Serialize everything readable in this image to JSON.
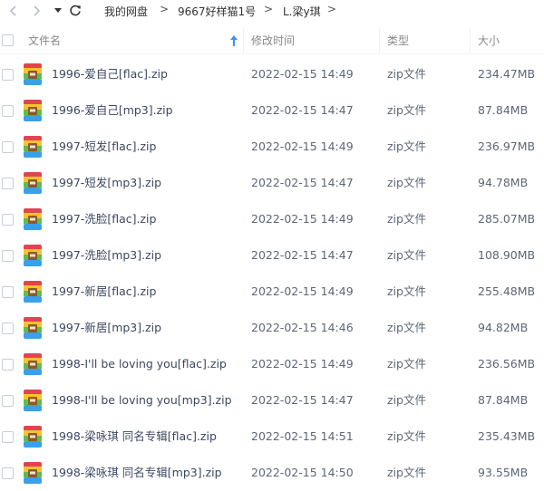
{
  "navigation": {
    "breadcrumbs": [
      "我的网盘",
      "9667好样猫1号",
      "L.梁y琪"
    ],
    "separator": ">"
  },
  "table": {
    "columns": {
      "name": "文件名",
      "modified": "修改时间",
      "type": "类型",
      "size": "大小"
    },
    "rows": [
      {
        "name": "1996-爱自己[flac].zip",
        "modified": "2022-02-15 14:49",
        "type": "zip文件",
        "size": "234.47MB"
      },
      {
        "name": "1996-爱自己[mp3].zip",
        "modified": "2022-02-15 14:47",
        "type": "zip文件",
        "size": "87.84MB"
      },
      {
        "name": "1997-短发[flac].zip",
        "modified": "2022-02-15 14:49",
        "type": "zip文件",
        "size": "236.97MB"
      },
      {
        "name": "1997-短发[mp3].zip",
        "modified": "2022-02-15 14:47",
        "type": "zip文件",
        "size": "94.78MB"
      },
      {
        "name": "1997-洗脸[flac].zip",
        "modified": "2022-02-15 14:49",
        "type": "zip文件",
        "size": "285.07MB"
      },
      {
        "name": "1997-洗脸[mp3].zip",
        "modified": "2022-02-15 14:47",
        "type": "zip文件",
        "size": "108.90MB"
      },
      {
        "name": "1997-新居[flac].zip",
        "modified": "2022-02-15 14:49",
        "type": "zip文件",
        "size": "255.48MB"
      },
      {
        "name": "1997-新居[mp3].zip",
        "modified": "2022-02-15 14:46",
        "type": "zip文件",
        "size": "94.82MB"
      },
      {
        "name": "1998-I'll be loving you[flac].zip",
        "modified": "2022-02-15 14:49",
        "type": "zip文件",
        "size": "236.56MB"
      },
      {
        "name": "1998-I'll be loving you[mp3].zip",
        "modified": "2022-02-15 14:47",
        "type": "zip文件",
        "size": "87.84MB"
      },
      {
        "name": "1998-梁咏琪 同名专辑[flac].zip",
        "modified": "2022-02-15 14:51",
        "type": "zip文件",
        "size": "235.43MB"
      },
      {
        "name": "1998-梁咏琪 同名专辑[mp3].zip",
        "modified": "2022-02-15 14:50",
        "type": "zip文件",
        "size": "93.55MB"
      }
    ]
  },
  "colors": {
    "accent": "#3b8cff",
    "zip_red": "#e2444f",
    "zip_green": "#5bbf4e",
    "zip_yellow": "#f7c32e",
    "zip_blue": "#3aa0e8"
  }
}
